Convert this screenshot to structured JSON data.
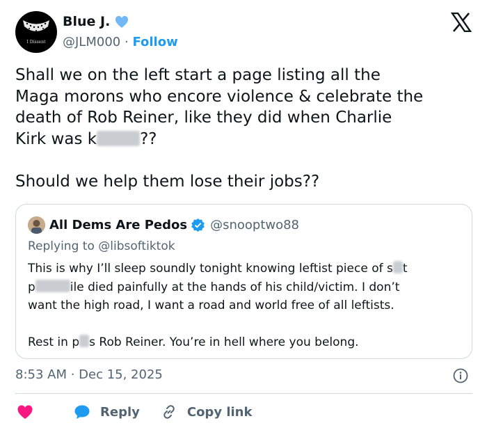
{
  "author": {
    "name": "Blue J.",
    "handle": "@JLM000",
    "separator": "·",
    "follow_label": "Follow",
    "avatar_caption": "I Dissent"
  },
  "tweet": {
    "text_part1": "Shall we on the left start a page listing all the\nMaga morons who encore violence & celebrate the\ndeath of Rob Reiner, like they did when Charlie\nKirk was k",
    "text_part2": "??\n\nShould we help them lose their jobs??",
    "timestamp": "8:53 AM · Dec 15, 2025"
  },
  "quote": {
    "name": "All Dems Are Pedos",
    "handle": "@snooptwo88",
    "replying_to": "Replying to @libsoftiktok",
    "body_a": "This is why I’ll sleep soundly tonight knowing leftist piece of s",
    "body_b": "t\np",
    "body_c": "ile died painfully at the hands of his child/victim. I don’t\nwant the high road, I want a road and world free of all leftists.\n\nRest in p",
    "body_d": "s Rob Reiner. You’re in hell where you belong."
  },
  "actions": {
    "reply_label": "Reply",
    "copy_label": "Copy link"
  },
  "colors": {
    "accent": "#1d9bf0",
    "like": "#f91880",
    "secondary_text": "#536471",
    "border": "#cfd9de"
  },
  "icons": [
    "verified-badge-icon",
    "x-logo-icon",
    "info-icon",
    "heart-icon",
    "reply-bubble-icon",
    "link-icon"
  ]
}
